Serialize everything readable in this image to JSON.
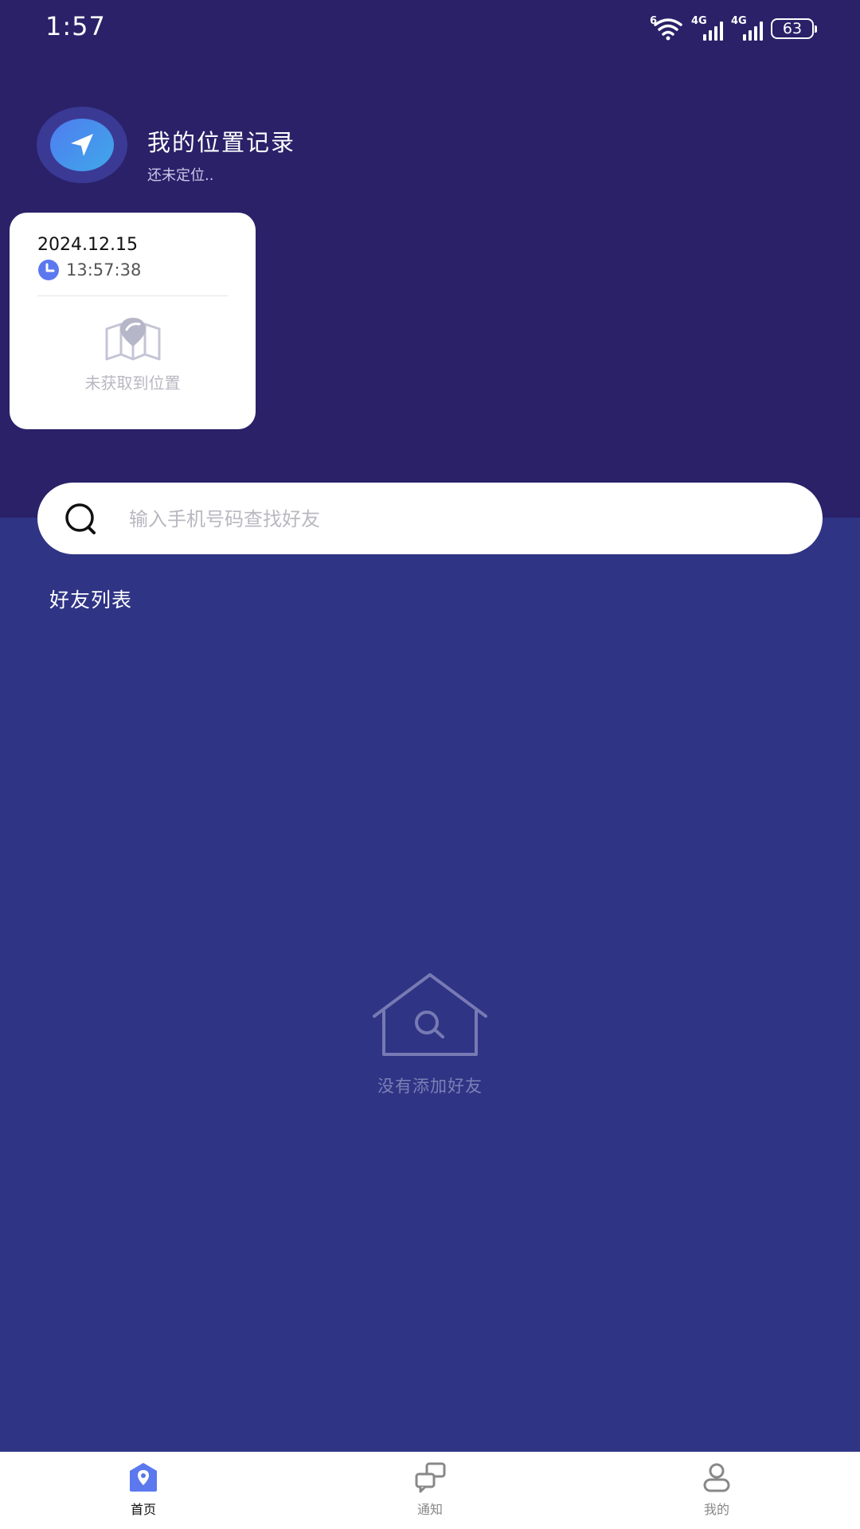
{
  "status_bar": {
    "time": "1:57",
    "wifi_tag": "6",
    "signal_tag_1": "4G",
    "signal_tag_2": "4G",
    "battery": "63"
  },
  "header": {
    "icon": "navigation-arrow-icon",
    "title": "我的位置记录",
    "subtitle": "还未定位.."
  },
  "location_card": {
    "date": "2024.12.15",
    "time": "13:57:38",
    "empty_text": "未获取到位置"
  },
  "search": {
    "placeholder": "输入手机号码查找好友",
    "value": ""
  },
  "friends": {
    "title": "好友列表",
    "empty_text": "没有添加好友"
  },
  "bottom_nav": {
    "items": [
      {
        "label": "首页",
        "icon": "home-location-icon",
        "active": true
      },
      {
        "label": "通知",
        "icon": "messages-icon",
        "active": false
      },
      {
        "label": "我的",
        "icon": "profile-icon",
        "active": false
      }
    ]
  },
  "colors": {
    "top_background": "#2a2169",
    "main_background": "#2f3485",
    "accent": "#5b78ef",
    "card": "#ffffff"
  }
}
